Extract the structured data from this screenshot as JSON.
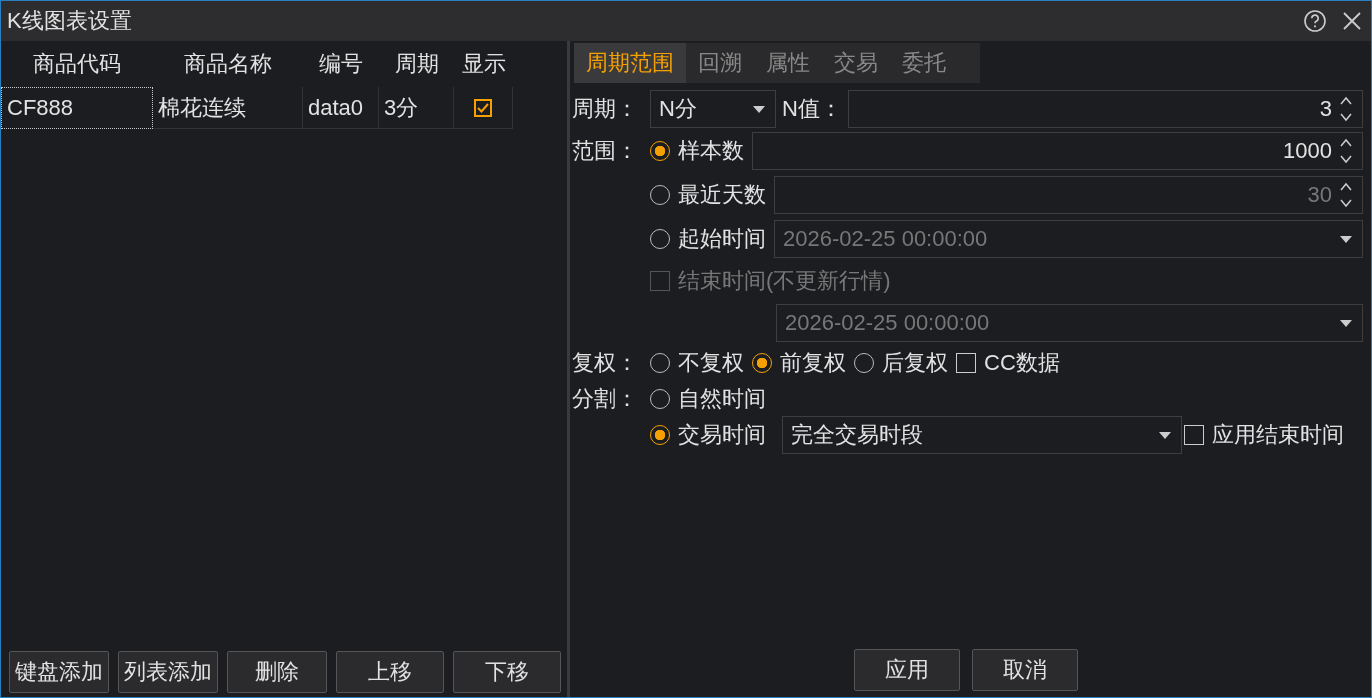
{
  "window": {
    "title": "K线图表设置"
  },
  "symbols": {
    "columns": [
      "商品代码",
      "商品名称",
      "编号",
      "周期",
      "显示"
    ],
    "rows": [
      {
        "code": "CF888",
        "name": "棉花连续",
        "id": "data0",
        "period": "3分",
        "shown": true,
        "focused": true
      }
    ],
    "buttons": [
      "键盘添加",
      "列表添加",
      "删除",
      "上移",
      "下移"
    ]
  },
  "tabs": [
    {
      "label": "周期范围",
      "selected": true
    },
    {
      "label": "回溯",
      "selected": false
    },
    {
      "label": "属性",
      "selected": false
    },
    {
      "label": "交易",
      "selected": false
    },
    {
      "label": "委托",
      "selected": false
    }
  ],
  "period": {
    "label": "周期：",
    "value": "N分",
    "n_label": "N值：",
    "n_value": "3"
  },
  "range": {
    "label": "范围：",
    "options": [
      {
        "label": "样本数",
        "selected": true,
        "field": {
          "kind": "spin",
          "value": "1000",
          "disabled": false
        }
      },
      {
        "label": "最近天数",
        "selected": false,
        "field": {
          "kind": "spin",
          "value": "30",
          "disabled": true
        }
      },
      {
        "label": "起始时间",
        "selected": false,
        "field": {
          "kind": "combo",
          "value": "2026-02-25 00:00:00",
          "disabled": true
        }
      }
    ]
  },
  "end_time": {
    "label": "结束时间(不更新行情)",
    "checked": false,
    "disabled": true,
    "value": "2026-02-25 00:00:00"
  },
  "adjust": {
    "label": "复权：",
    "options": [
      {
        "label": "不复权",
        "selected": false
      },
      {
        "label": "前复权",
        "selected": true
      },
      {
        "label": "后复权",
        "selected": false
      }
    ],
    "cc": {
      "label": "CC数据",
      "checked": false
    }
  },
  "split": {
    "label": "分割：",
    "options": [
      {
        "label": "自然时间",
        "selected": false
      },
      {
        "label": "交易时间",
        "selected": true
      }
    ],
    "session": "完全交易时段",
    "apply_end": {
      "label": "应用结束时间",
      "checked": false
    }
  },
  "footer_buttons": [
    "应用",
    "取消"
  ]
}
